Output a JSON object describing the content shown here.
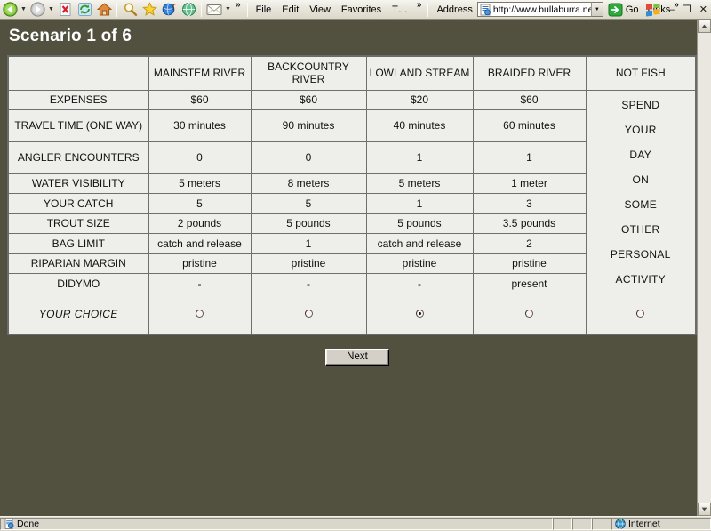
{
  "browser": {
    "toolbar_icons": [
      "back-icon",
      "forward-icon",
      "stop-icon",
      "refresh-icon",
      "home-icon",
      "search-icon",
      "favorites-icon",
      "media-icon",
      "history-icon",
      "mail-icon"
    ],
    "menus": [
      "File",
      "Edit",
      "View",
      "Favorites",
      "T…"
    ],
    "overflow_label": "»",
    "address_label": "Address",
    "address_value": "http://www.bullaburra.net/c",
    "go_label": "Go",
    "links_label": "Links",
    "window_buttons": [
      "–",
      "❐",
      "✕"
    ]
  },
  "page": {
    "title": "Scenario 1 of 6",
    "next_label": "Next"
  },
  "table": {
    "corner": "",
    "columns": [
      {
        "id": "mainstem",
        "label": "MAINSTEM RIVER"
      },
      {
        "id": "backcountry",
        "label": "BACKCOUNTRY RIVER"
      },
      {
        "id": "lowland",
        "label": "LOWLAND STREAM"
      },
      {
        "id": "braided",
        "label": "BRAIDED RIVER"
      },
      {
        "id": "notfish",
        "label": "NOT FISH"
      }
    ],
    "rows": [
      {
        "label": "EXPENSES",
        "values": [
          "$60",
          "$60",
          "$20",
          "$60"
        ]
      },
      {
        "label": "TRAVEL TIME (ONE WAY)",
        "values": [
          "30 minutes",
          "90 minutes",
          "40 minutes",
          "60 minutes"
        ]
      },
      {
        "label": "ANGLER ENCOUNTERS",
        "values": [
          "0",
          "0",
          "1",
          "1"
        ]
      },
      {
        "label": "WATER VISIBILITY",
        "values": [
          "5 meters",
          "8 meters",
          "5 meters",
          "1 meter"
        ]
      },
      {
        "label": "YOUR CATCH",
        "values": [
          "5",
          "5",
          "1",
          "3"
        ]
      },
      {
        "label": "TROUT SIZE",
        "values": [
          "2 pounds",
          "5 pounds",
          "5 pounds",
          "3.5 pounds"
        ]
      },
      {
        "label": "BAG LIMIT",
        "values": [
          "catch and release",
          "1",
          "catch and release",
          "2"
        ]
      },
      {
        "label": "RIPARIAN MARGIN",
        "values": [
          "pristine",
          "pristine",
          "pristine",
          "pristine"
        ]
      },
      {
        "label": "DIDYMO",
        "values": [
          "-",
          "-",
          "-",
          "present"
        ]
      }
    ],
    "notfish_lines": [
      "SPEND",
      "YOUR",
      "DAY",
      "ON",
      "SOME",
      "OTHER",
      "PERSONAL",
      "ACTIVITY"
    ],
    "choice_label": "YOUR CHOICE",
    "choice_selected": "lowland"
  },
  "statusbar": {
    "message": "Done",
    "zone": "Internet"
  },
  "colors": {
    "page_background": "#52503f",
    "header_cell": "#e0f7fb",
    "row_header": "#ddd5cc",
    "data_cell": "#eeeeea",
    "title_text": "#ffffff"
  }
}
